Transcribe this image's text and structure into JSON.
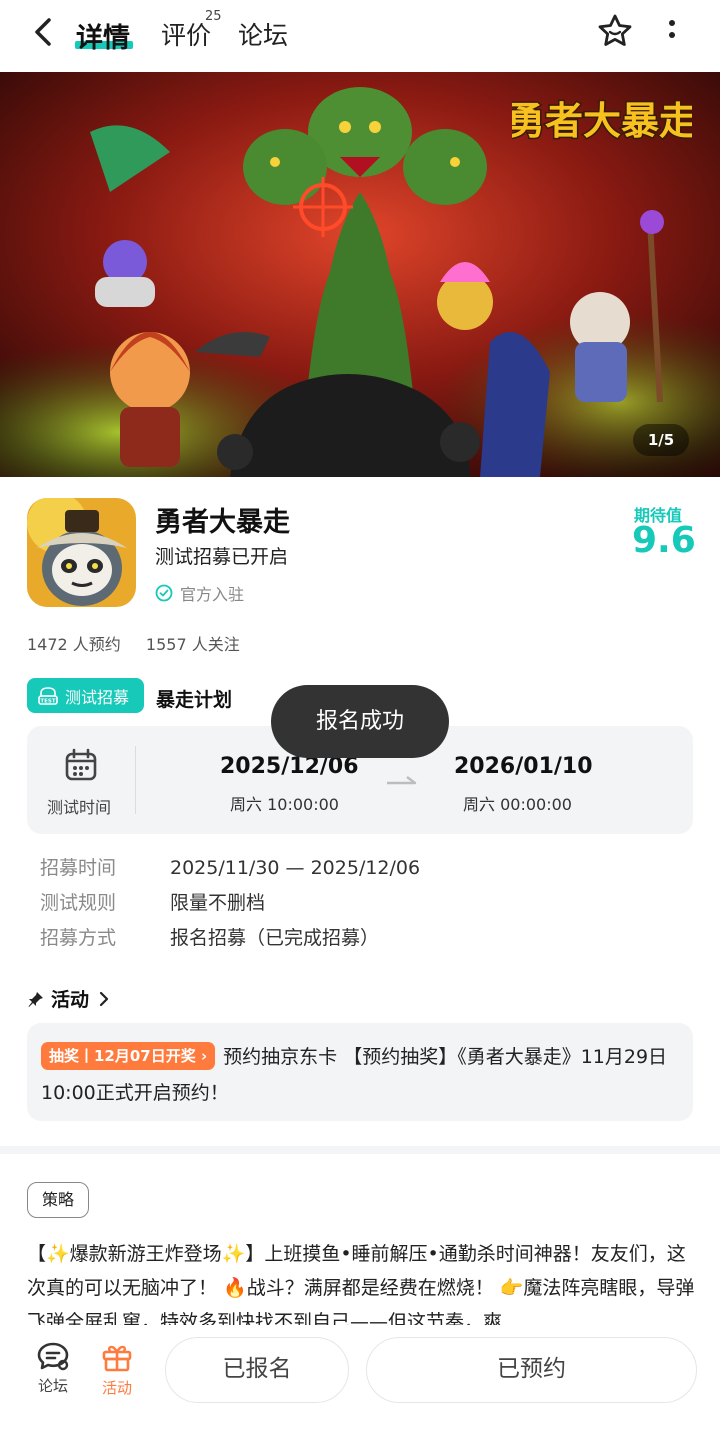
{
  "header": {
    "tabs": [
      {
        "label": "详情",
        "active": true
      },
      {
        "label": "评价",
        "count": "25"
      },
      {
        "label": "论坛"
      }
    ],
    "icons": [
      "back-icon",
      "star-icon",
      "more-icon"
    ]
  },
  "banner": {
    "logo_text": "勇者大暴走",
    "counter": "1/5"
  },
  "game": {
    "title": "勇者大暴走",
    "subtitle": "测试招募已开启",
    "official": "官方入驻",
    "expect_label": "期待值",
    "expect_score": "9.6",
    "reservations": "1472 人预约",
    "follows": "1557 人关注",
    "accent_color": "#16c9b9"
  },
  "test": {
    "badge": "测试招募",
    "plan_name": "暴走计划",
    "time_label": "测试时间",
    "start_date": "2025/12/06",
    "start_time": "周六  10:00:00",
    "end_date": "2026/01/10",
    "end_time": "周六  00:00:00",
    "info": [
      {
        "key": "招募时间",
        "value": "2025/11/30 — 2025/12/06"
      },
      {
        "key": "测试规则",
        "value": "限量不删档"
      },
      {
        "key": "招募方式",
        "value": "报名招募（已完成招募）"
      }
    ]
  },
  "toast": "报名成功",
  "activity": {
    "heading": "活动",
    "tag": "抽奖丨12月07日开奖",
    "text": "预约抽京东卡 【预约抽奖】《勇者大暴走》11月29日10:00正式开启预约！",
    "tag_color": "#ff7a3d"
  },
  "strategy": {
    "tag": "策略",
    "text": "【✨爆款新游王炸登场✨】上班摸鱼•睡前解压•通勤杀时间神器！友友们，这次真的可以无脑冲了！ 🔥战斗？满屏都是经费在燃烧！ 👉魔法阵亮瞎眼，导弹飞弹全屏乱窜，特效多到快找不到自己——但这节奏，爽..."
  },
  "bottom_bar": {
    "forum": "论坛",
    "activity": "活动",
    "signed_button": "已报名",
    "reserved_button": "已预约"
  }
}
